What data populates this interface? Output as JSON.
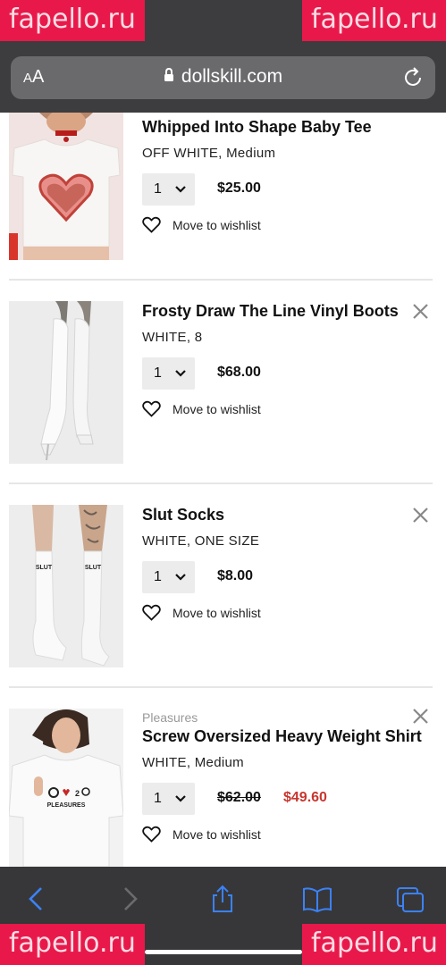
{
  "watermark": {
    "text": "fapello.ru"
  },
  "browser": {
    "text_size_button": {
      "small": "A",
      "large": "A"
    },
    "url": "dollskill.com"
  },
  "cart": {
    "wishlist_label": "Move to wishlist",
    "items": [
      {
        "brand": "",
        "name": "Whipped Into Shape Baby Tee",
        "variant": "OFF WHITE, Medium",
        "quantity": "1",
        "price": "$25.00"
      },
      {
        "brand": "",
        "name": "Frosty Draw The Line Vinyl Boots",
        "variant": "WHITE, 8",
        "quantity": "1",
        "price": "$68.00"
      },
      {
        "brand": "",
        "name": "Slut Socks",
        "variant": "WHITE, ONE SIZE",
        "quantity": "1",
        "price": "$8.00",
        "sock_print": "SLUT"
      },
      {
        "brand": "Pleasures",
        "name": "Screw Oversized Heavy Weight Shirt",
        "variant": "WHITE, Medium",
        "quantity": "1",
        "original_price": "$62.00",
        "sale_price": "$49.60",
        "shirt_print": "PLEASURES"
      }
    ]
  },
  "colors": {
    "sale_price": "#c7362f",
    "toolbar_icon": "#3b82f6",
    "toolbar_disabled": "#6b6b6f",
    "chrome": "#3d3d3f",
    "watermark": "#e8194a"
  },
  "icons": [
    "lock-icon",
    "reload-icon",
    "chevron-down-icon",
    "heart-icon",
    "close-icon",
    "back-icon",
    "forward-icon",
    "share-icon",
    "bookmarks-icon",
    "tabs-icon"
  ]
}
